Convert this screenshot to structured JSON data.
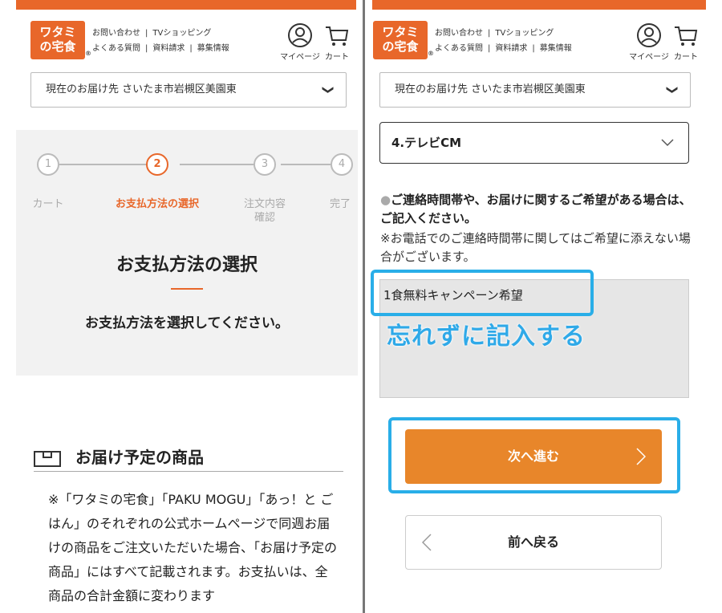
{
  "header": {
    "logo_line1": "ワタミ",
    "logo_line2": "の宅食",
    "logo_reg": "®",
    "links_row1": [
      "お問い合わせ",
      "TVショッピング"
    ],
    "links_row2": [
      "よくある質問",
      "資料請求",
      "募集情報"
    ],
    "separator": "|",
    "mypage_label": "マイページ",
    "cart_label": "カート"
  },
  "address": {
    "text": "現在のお届け先 さいたま市岩槻区美園東",
    "chevron": "❯"
  },
  "steps": {
    "items": [
      {
        "number": "1",
        "label": "カート"
      },
      {
        "number": "2",
        "label": "お支払方法の選択"
      },
      {
        "number": "3",
        "label": "注文内容確認"
      },
      {
        "number": "4",
        "label": "完了"
      }
    ],
    "title": "お支払方法の選択",
    "subtitle": "お支払方法を選択してください。"
  },
  "products": {
    "title": "お届け予定の商品",
    "note": "※「ワタミの宅食」「PAKU MOGU」「あっ！と ごはん」のそれぞれの公式ホームページで同週お届けの商品をご注文いただいた場合、「お届け予定の商品」にはすべて記載されます。お支払いは、全商品の合計金額に変わります"
  },
  "form": {
    "select_value": "4.テレビCM",
    "request_label": "ご連絡時間帯や、お届けに関するご希望がある場合は、ご記入ください。",
    "request_note": "※お電話でのご連絡時間帯に関してはご希望に添えない場合がございます。",
    "textarea_value": "1食無料キャンペーン希望",
    "annotation": "忘れずに記入する",
    "next_label": "次へ進む",
    "back_label": "前へ戻る"
  },
  "colors": {
    "brand": "#e8672a",
    "button": "#e8862a",
    "highlight": "#29aee8"
  }
}
